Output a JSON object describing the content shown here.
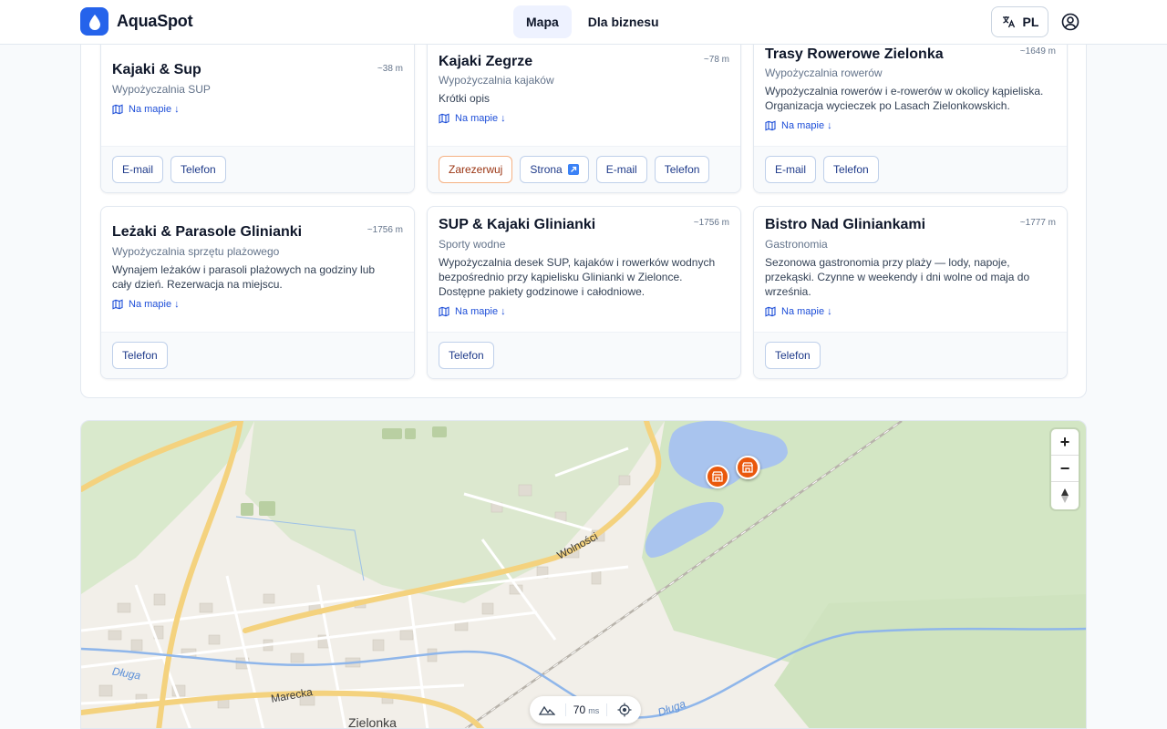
{
  "app": {
    "name": "AquaSpot"
  },
  "nav": {
    "map": "Mapa",
    "business": "Dla biznesu"
  },
  "language": {
    "code": "PL"
  },
  "labels": {
    "on_map": "Na mapie ↓"
  },
  "cards": [
    {
      "title": "Kajaki & Sup",
      "distance": "~38 m",
      "category": "Wypożyczalnia SUP",
      "description": "",
      "actions": [
        "E-mail",
        "Telefon"
      ]
    },
    {
      "title": "Kajaki Zegrze",
      "distance": "~78 m",
      "category": "Wypożyczalnia kajaków",
      "description": "Krótki opis",
      "actions": [
        "Zarezerwuj",
        "Strona",
        "E-mail",
        "Telefon"
      ]
    },
    {
      "title": "Trasy Rowerowe Zielonka",
      "distance": "~1649 m",
      "category": "Wypożyczalnia rowerów",
      "description": "Wypożyczalnia rowerów i e-rowerów w okolicy kąpieliska. Organizacja wycieczek po Lasach Zielonkowskich.",
      "actions": [
        "E-mail",
        "Telefon"
      ]
    },
    {
      "title": "Leżaki & Parasole Glinianki",
      "distance": "~1756 m",
      "category": "Wypożyczalnia sprzętu plażowego",
      "description": "Wynajem leżaków i parasoli plażowych na godziny lub cały dzień. Rezerwacja na miejscu.",
      "actions": [
        "Telefon"
      ]
    },
    {
      "title": "SUP & Kajaki Glinianki",
      "distance": "~1756 m",
      "category": "Sporty wodne",
      "description": "Wypożyczalnia desek SUP, kajaków i rowerków wodnych bezpośrednio przy kąpielisku Glinianki w Zielonce. Dostępne pakiety godzinowe i całodniowe.",
      "actions": [
        "Telefon"
      ]
    },
    {
      "title": "Bistro Nad Gliniankami",
      "distance": "~1777 m",
      "category": "Gastronomia",
      "description": "Sezonowa gastronomia przy plaży — lody, napoje, przekąski. Czynne w weekendy i dni wolne od maja do września.",
      "actions": [
        "Telefon"
      ]
    }
  ],
  "map": {
    "street_labels": [
      "Wolności",
      "Długa",
      "Marecka",
      "Długa"
    ],
    "place_label": "Zielonka",
    "zoom_in": "+",
    "zoom_out": "−",
    "latency_value": "70",
    "latency_unit": "ms"
  },
  "colors": {
    "accent": "#2563eb",
    "poi": "#ea580c",
    "water": "#a9c4ee",
    "forest": "#d6e8c9"
  }
}
